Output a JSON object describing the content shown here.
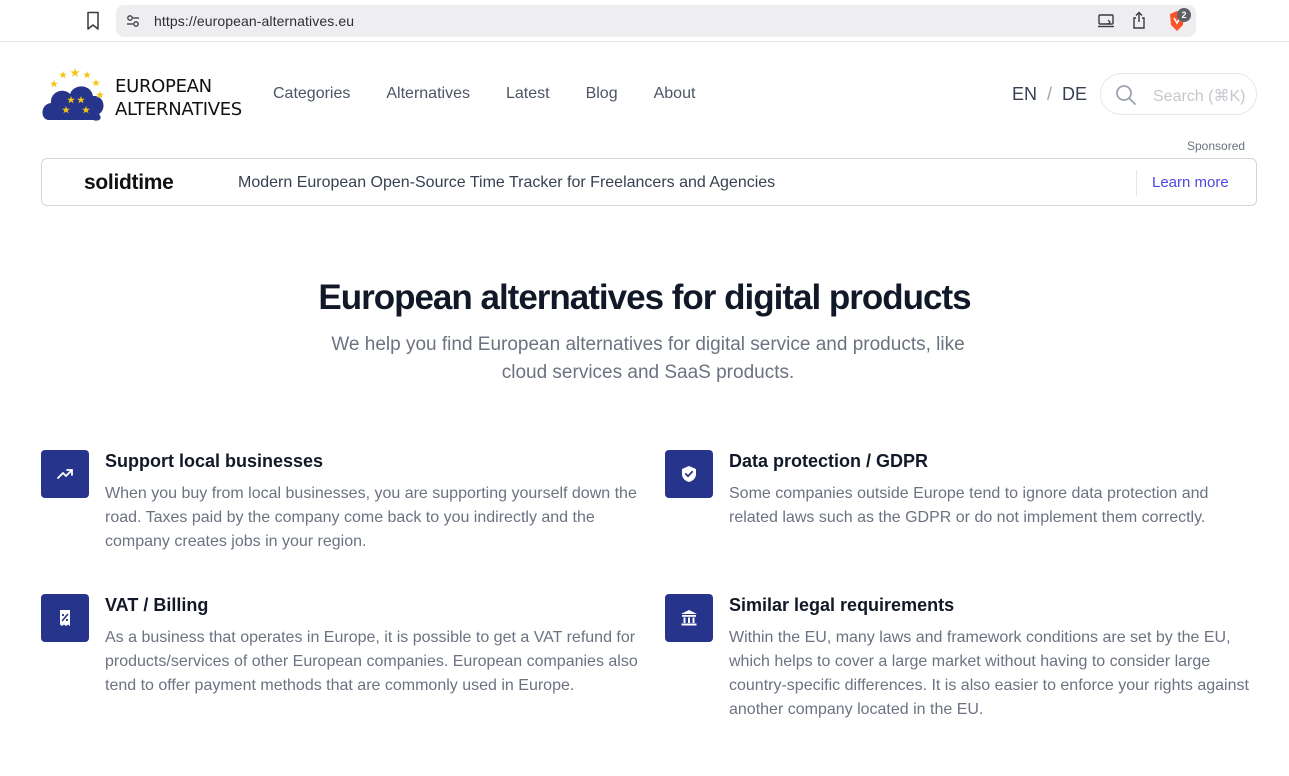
{
  "browser": {
    "url": "https://european-alternatives.eu",
    "brave_badge": "2"
  },
  "header": {
    "logo_line1": "EUROPEAN",
    "logo_line2": "ALTERNATIVES",
    "nav": [
      "Categories",
      "Alternatives",
      "Latest",
      "Blog",
      "About"
    ],
    "lang_en": "EN",
    "lang_sep": "/",
    "lang_de": "DE",
    "search_placeholder": "Search (⌘K)"
  },
  "sponsor": {
    "label": "Sponsored",
    "brand": "solidtime",
    "text": "Modern European Open-Source Time Tracker for Freelancers and Agencies",
    "cta": "Learn more"
  },
  "hero": {
    "title": "European alternatives for digital products",
    "subtitle": "We help you find European alternatives for digital service and products, like cloud services and SaaS products."
  },
  "features": [
    {
      "icon": "trending-up-icon",
      "title": "Support local businesses",
      "description": "When you buy from local businesses, you are supporting yourself down the road. Taxes paid by the company come back to you indirectly and the company creates jobs in your region."
    },
    {
      "icon": "shield-check-icon",
      "title": "Data protection / GDPR",
      "description": "Some companies outside Europe tend to ignore data protection and related laws such as the GDPR or do not implement them correctly."
    },
    {
      "icon": "receipt-percent-icon",
      "title": "VAT / Billing",
      "description": "As a business that operates in Europe, it is possible to get a VAT refund for products/services of other European companies. European companies also tend to offer payment methods that are commonly used in Europe."
    },
    {
      "icon": "building-library-icon",
      "title": "Similar legal requirements",
      "description": "Within the EU, many laws and framework conditions are set by the EU, which helps to cover a large market without having to consider large country-specific differences. It is also easier to enforce your rights against another company located in the EU."
    }
  ],
  "colors": {
    "brand_blue": "#27348b",
    "star_yellow": "#f5c518",
    "link_indigo": "#4f46e5"
  }
}
